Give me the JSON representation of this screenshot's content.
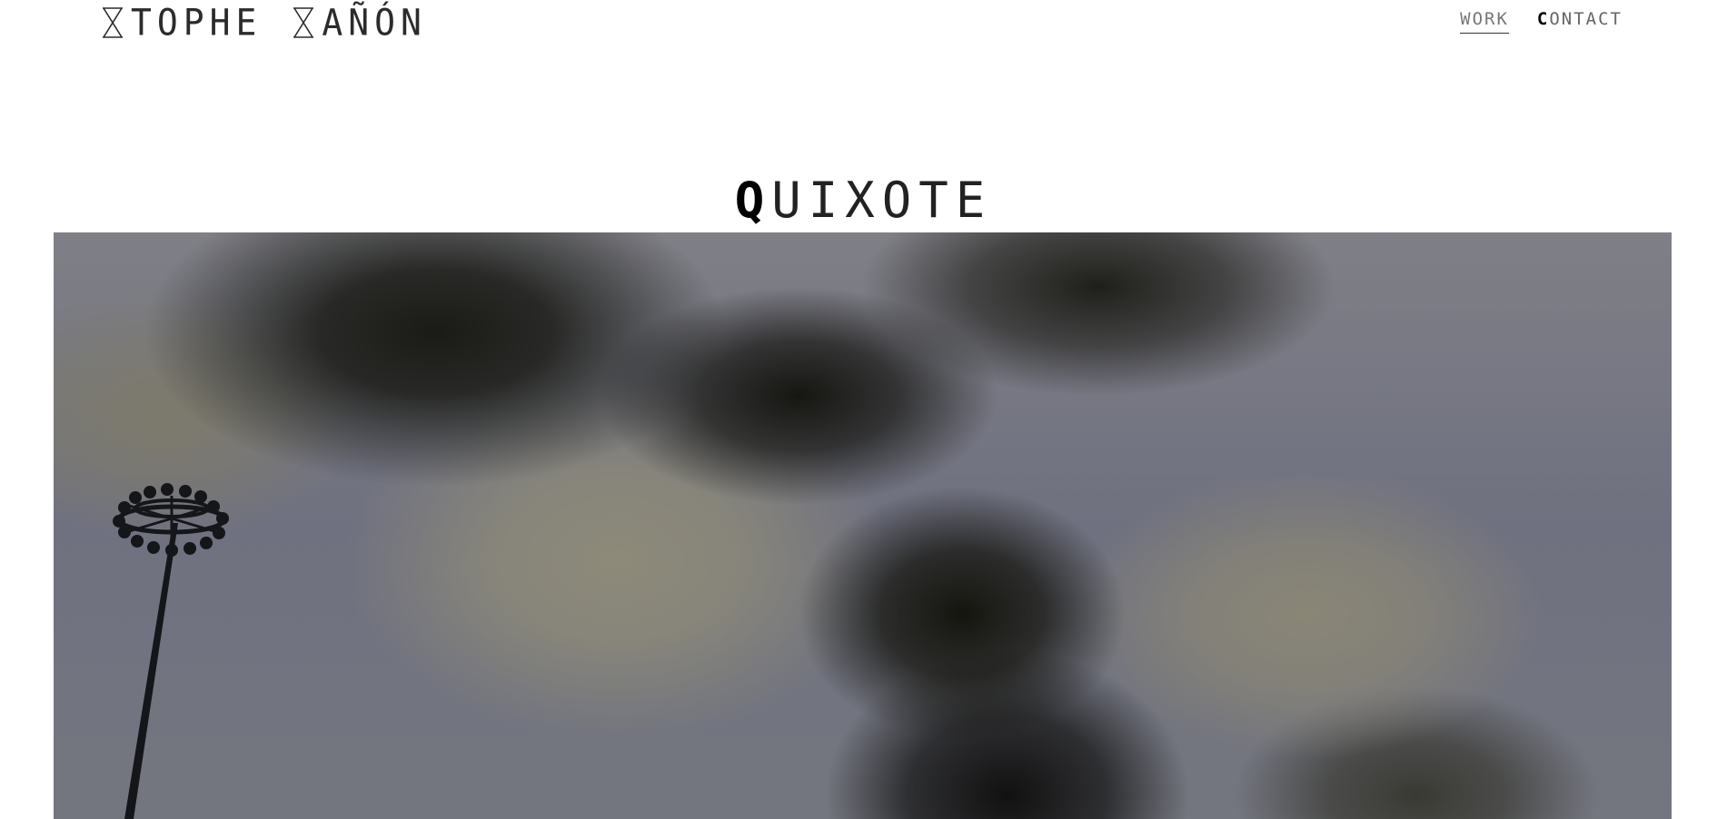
{
  "header": {
    "logo": {
      "word1": "TOPHE",
      "word2": "AÑÓN",
      "glyph_icon": "hourglass-icon"
    },
    "nav": {
      "items": [
        {
          "label": "WORK",
          "active": true
        },
        {
          "first_letter": "C",
          "rest": "ONTACT",
          "active": false
        }
      ]
    }
  },
  "main": {
    "title": {
      "first_letter": "Q",
      "rest": "UIXOTE"
    },
    "hero_image": {
      "subject": "cloudy sky with stadium floodlight",
      "colors": {
        "sky": "#717380",
        "cloud_dark": "#1a1b16",
        "cloud_light": "#8d8a79"
      }
    }
  }
}
